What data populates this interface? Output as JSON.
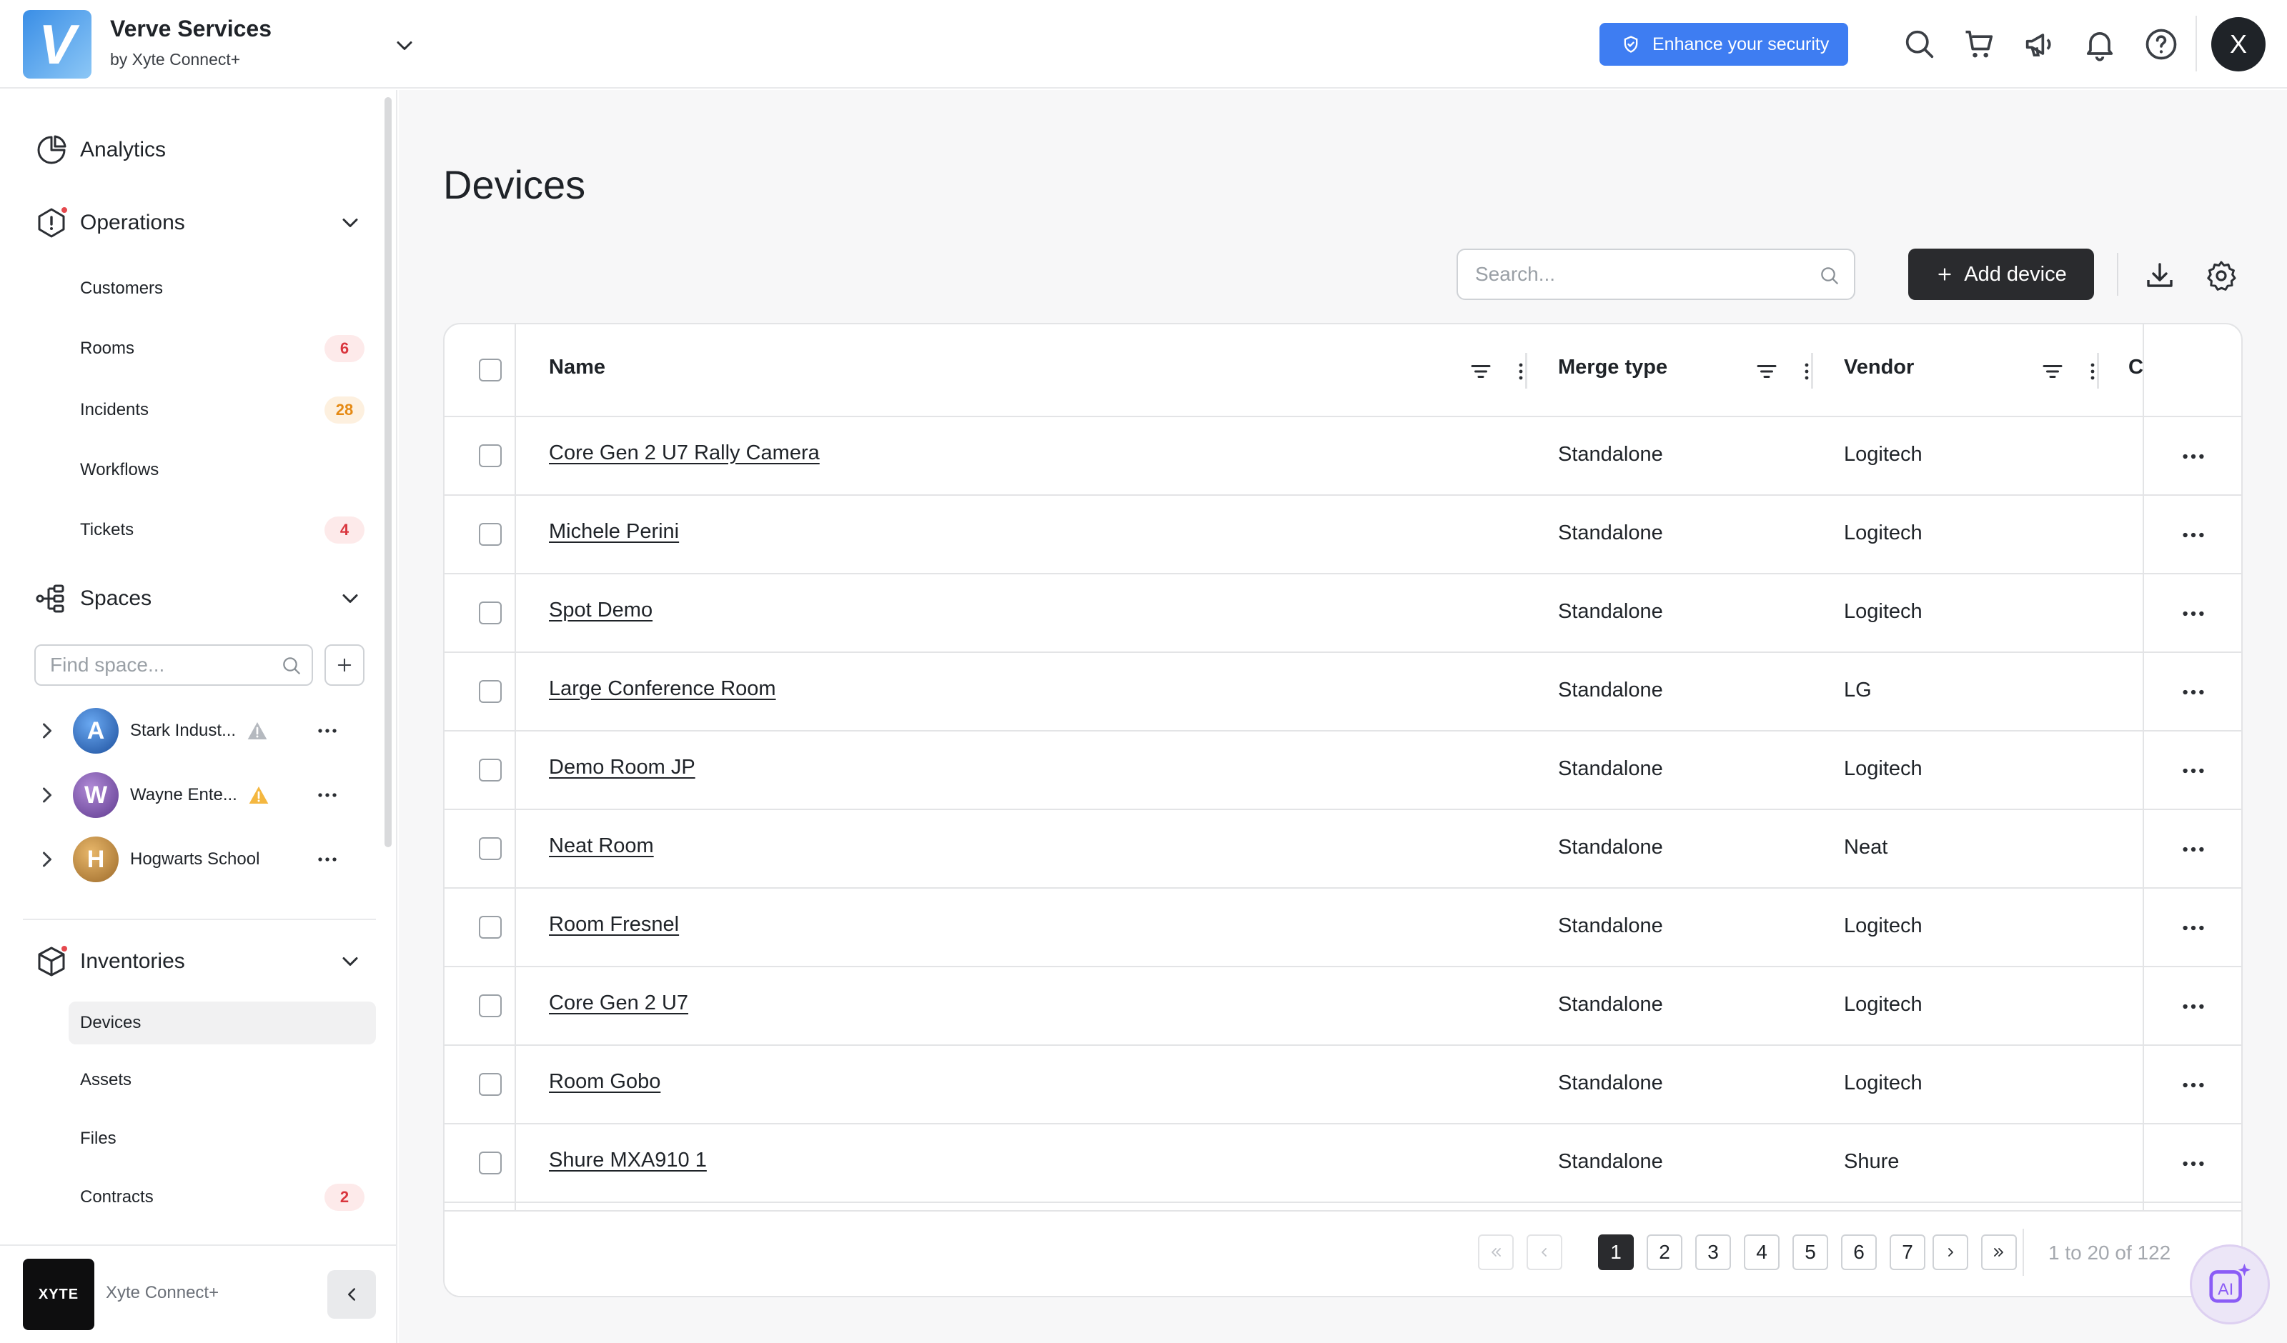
{
  "header": {
    "logo_letter": "V",
    "org_name": "Verve Services",
    "org_sub": "by Xyte Connect+",
    "security_label": "Enhance your security",
    "avatar_letter": "X",
    "accent": "#3e7df2"
  },
  "sidebar": {
    "analytics": "Analytics",
    "operations": "Operations",
    "operations_items": [
      {
        "label": "Customers",
        "badge": ""
      },
      {
        "label": "Rooms",
        "badge": "6"
      },
      {
        "label": "Incidents",
        "badge": "28"
      },
      {
        "label": "Workflows",
        "badge": ""
      },
      {
        "label": "Tickets",
        "badge": "4"
      }
    ],
    "spaces": "Spaces",
    "find_space_placeholder": "Find space...",
    "space_list": [
      {
        "name": "Stark Indust...",
        "warning": true
      },
      {
        "name": "Wayne Ente...",
        "warning": true
      },
      {
        "name": "Hogwarts School",
        "warning": false
      }
    ],
    "inventories": "Inventories",
    "inventory_items": [
      {
        "label": "Devices",
        "badge": ""
      },
      {
        "label": "Assets",
        "badge": ""
      },
      {
        "label": "Files",
        "badge": ""
      },
      {
        "label": "Contracts",
        "badge": "2"
      }
    ],
    "footer_logo_text": "XYTE",
    "footer_name": "Xyte Connect+"
  },
  "main": {
    "title": "Devices",
    "search_placeholder": "Search...",
    "add_label": "Add device",
    "columns": {
      "name": "Name",
      "merge": "Merge type",
      "vendor": "Vendor",
      "next": "C"
    },
    "rows": [
      {
        "name": "Core Gen 2 U7 Rally Camera",
        "merge": "Standalone",
        "vendor": "Logitech"
      },
      {
        "name": "Michele Perini",
        "merge": "Standalone",
        "vendor": "Logitech"
      },
      {
        "name": "Spot Demo",
        "merge": "Standalone",
        "vendor": "Logitech"
      },
      {
        "name": "Large Conference Room",
        "merge": "Standalone",
        "vendor": "LG"
      },
      {
        "name": "Demo Room JP",
        "merge": "Standalone",
        "vendor": "Logitech"
      },
      {
        "name": "Neat Room",
        "merge": "Standalone",
        "vendor": "Neat"
      },
      {
        "name": "Room Fresnel",
        "merge": "Standalone",
        "vendor": "Logitech"
      },
      {
        "name": "Core Gen 2 U7",
        "merge": "Standalone",
        "vendor": "Logitech"
      },
      {
        "name": "Room Gobo",
        "merge": "Standalone",
        "vendor": "Logitech"
      },
      {
        "name": "Shure MXA910 1",
        "merge": "Standalone",
        "vendor": "Shure"
      }
    ],
    "pagination": {
      "pages": [
        "1",
        "2",
        "3",
        "4",
        "5",
        "6",
        "7"
      ],
      "current": "1",
      "range": "1 to 20 of 122"
    }
  }
}
